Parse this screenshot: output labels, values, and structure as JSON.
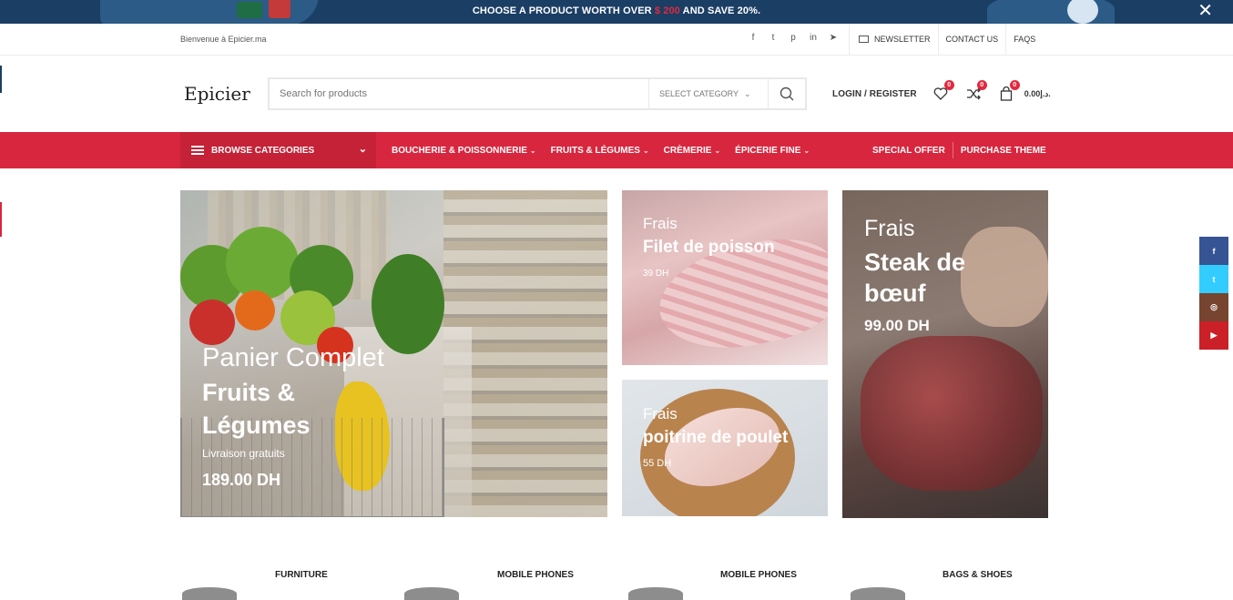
{
  "promo": {
    "text_before": "CHOOSE A PRODUCT WORTH OVER ",
    "price": "$ 200",
    "text_after": " AND SAVE 20%.",
    "close": "✕"
  },
  "topbar": {
    "welcome": "Bienvenue à Epicier.ma",
    "socials": [
      "f",
      "t",
      "p",
      "in",
      "➤"
    ],
    "newsletter": "NEWSLETTER",
    "contact": "CONTACT US",
    "faqs": "FAQS"
  },
  "header": {
    "logo": "Epicier",
    "search_placeholder": "Search for products",
    "category_select": "SELECT CATEGORY",
    "login": "LOGIN / REGISTER",
    "wishlist_count": "0",
    "compare_count": "0",
    "cart_count": "0",
    "cart_total": "0.00د.إ."
  },
  "nav": {
    "browse": "BROWSE CATEGORIES",
    "items": [
      "BOUCHERIE & POISSONNERIE",
      "FRUITS & LÉGUMES",
      "CRÈMERIE",
      "ÉPICERIE FINE"
    ],
    "right": [
      "SPECIAL OFFER",
      "PURCHASE THEME"
    ]
  },
  "banners": [
    {
      "line1": "Panier Complet",
      "line2": "Fruits &",
      "line2b": "Légumes",
      "line3": "Livraison gratuits",
      "price": "189.00 DH"
    },
    {
      "line1": "Frais",
      "line2": "Filet de poisson",
      "price": "39 DH"
    },
    {
      "line1": "Frais",
      "line2": "poitrine de poulet",
      "price": "55 DH"
    },
    {
      "line1": "Frais",
      "line2": "Steak de",
      "line2b": "bœuf",
      "price": "99.00 DH"
    }
  ],
  "social_float": [
    {
      "icon": "facebook-icon",
      "glyph": "f",
      "color": "#365493"
    },
    {
      "icon": "twitter-icon",
      "glyph": "t",
      "color": "#3cf"
    },
    {
      "icon": "instagram-icon",
      "glyph": "◎",
      "color": "#774430"
    },
    {
      "icon": "youtube-icon",
      "glyph": "▶",
      "color": "#cb2027"
    }
  ],
  "categories": [
    "FURNITURE",
    "MOBILE PHONES",
    "MOBILE PHONES",
    "BAGS & SHOES"
  ],
  "colors": {
    "accent": "#d8263e",
    "promo_bg": "#1b3e64"
  }
}
